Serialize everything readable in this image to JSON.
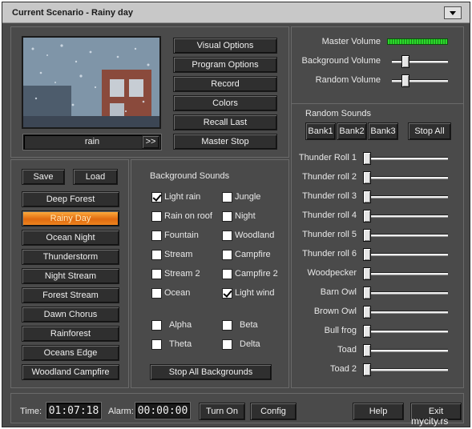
{
  "window": {
    "title": "Current Scenario - Rainy day"
  },
  "preview": {
    "caption": "rain",
    "expand_label": ">>"
  },
  "options": [
    "Visual Options",
    "Program Options",
    "Record",
    "Colors",
    "Recall Last",
    "Master Stop"
  ],
  "volumes": [
    {
      "label": "Master Volume",
      "level": 1.0
    },
    {
      "label": "Background Volume",
      "level": 0.2
    },
    {
      "label": "Random Volume",
      "level": 0.2
    }
  ],
  "scenario": {
    "save_label": "Save",
    "load_label": "Load",
    "items": [
      "Deep Forest",
      "Rainy Day",
      "Ocean Night",
      "Thunderstorm",
      "Night Stream",
      "Forest Stream",
      "Dawn Chorus",
      "Rainforest",
      "Oceans Edge",
      "Woodland Campfire"
    ],
    "active": "Rainy Day"
  },
  "background": {
    "heading": "Background Sounds",
    "sounds": [
      {
        "label": "Light rain",
        "checked": true
      },
      {
        "label": "Jungle",
        "checked": false
      },
      {
        "label": "Rain on roof",
        "checked": false
      },
      {
        "label": "Night",
        "checked": false
      },
      {
        "label": "Fountain",
        "checked": false
      },
      {
        "label": "Woodland",
        "checked": false
      },
      {
        "label": "Stream",
        "checked": false
      },
      {
        "label": "Campfire",
        "checked": false
      },
      {
        "label": "Stream 2",
        "checked": false
      },
      {
        "label": "Campfire 2",
        "checked": false
      },
      {
        "label": "Ocean",
        "checked": false
      },
      {
        "label": "Light wind",
        "checked": true
      }
    ],
    "waves": [
      {
        "label": "Alpha",
        "checked": false
      },
      {
        "label": "Beta",
        "checked": false
      },
      {
        "label": "Theta",
        "checked": false
      },
      {
        "label": "Delta",
        "checked": false
      }
    ],
    "stop_all_label": "Stop All Backgrounds"
  },
  "random": {
    "heading": "Random Sounds",
    "banks": [
      "Bank1",
      "Bank2",
      "Bank3"
    ],
    "stop_all_label": "Stop All",
    "sounds": [
      {
        "label": "Thunder Roll 1",
        "level": 0
      },
      {
        "label": "Thunder roll 2",
        "level": 0
      },
      {
        "label": "Thunder roll 3",
        "level": 0
      },
      {
        "label": "Thunder roll 4",
        "level": 0
      },
      {
        "label": "Thunder roll 5",
        "level": 0
      },
      {
        "label": "Thunder roll 6",
        "level": 0
      },
      {
        "label": "Woodpecker",
        "level": 0
      },
      {
        "label": "Barn Owl",
        "level": 0
      },
      {
        "label": "Brown Owl",
        "level": 0
      },
      {
        "label": "Bull frog",
        "level": 0
      },
      {
        "label": "Toad",
        "level": 0
      },
      {
        "label": "Toad 2",
        "level": 0
      }
    ]
  },
  "status": {
    "time_label": "Time:",
    "time_value": "01:07:18",
    "alarm_label": "Alarm:",
    "alarm_value": "00:00:00",
    "turn_on_label": "Turn On",
    "config_label": "Config",
    "help_label": "Help",
    "exit_label": "Exit",
    "watermark": "mycity.rs"
  },
  "colors": {
    "accent": "#f08820",
    "meter": "#2bd82b",
    "background": "#4a4a4a"
  }
}
